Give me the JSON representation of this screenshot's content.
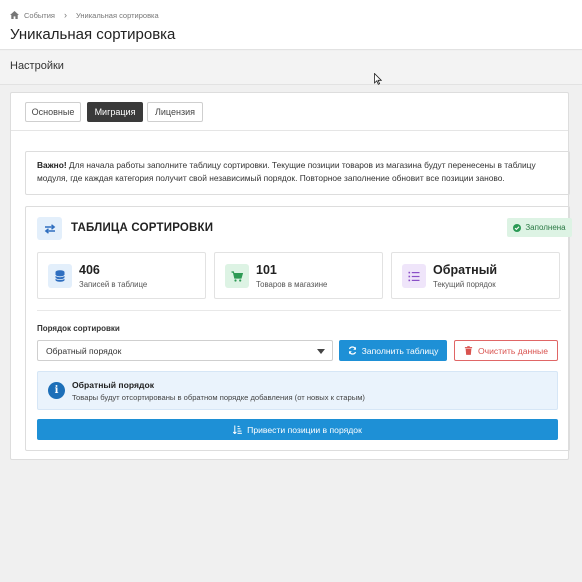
{
  "breadcrumb": {
    "home_icon": "home-icon",
    "items": [
      "События",
      "Уникальная сортировка"
    ],
    "separator": "›"
  },
  "page": {
    "title": "Уникальная сортировка",
    "section": "Настройки"
  },
  "tabs": [
    {
      "label": "Основные",
      "active": false
    },
    {
      "label": "Миграция",
      "active": true
    },
    {
      "label": "Лицензия",
      "active": false
    }
  ],
  "alert": {
    "bold": "Важно!",
    "text": " Для начала работы заполните таблицу сортировки. Текущие позиции товаров из магазина будут перенесены в таблицу модуля, где каждая категория получит свой независимый порядок. Повторное заполнение обновит все позиции заново."
  },
  "card": {
    "icon": "exchange-icon",
    "title": "ТАБЛИЦА СОРТИРОВКИ",
    "badge": {
      "label": "Заполнена",
      "icon": "check-circle-icon",
      "color": "#2b7a45"
    }
  },
  "stats": [
    {
      "value": "406",
      "label": "Записей в таблице",
      "icon": "database-icon",
      "color": "#2f6fc0"
    },
    {
      "value": "101",
      "label": "Товаров в магазине",
      "icon": "cart-icon",
      "color": "#2e9a55"
    },
    {
      "value": "Обратный",
      "label": "Текущий порядок",
      "icon": "list-icon",
      "color": "#8a4fc7"
    }
  ],
  "sort": {
    "label": "Порядок сортировки",
    "selected": "Обратный порядок",
    "fill_button": "Заполнить таблицу",
    "clear_button": "Очистить данные"
  },
  "info": {
    "title": "Обратный порядок",
    "text": "Товары будут отсортированы в обратном порядке добавления (от новых к старым)"
  },
  "main_button": "Привести позиции в порядок",
  "colors": {
    "primary": "#1e90d6",
    "danger": "#d9534f",
    "success_bg": "#ddf3e4"
  }
}
